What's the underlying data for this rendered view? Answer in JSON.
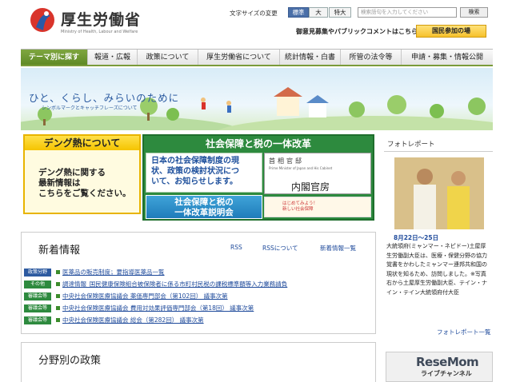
{
  "header": {
    "title": "厚生労働省",
    "subtitle": "Ministry of Health, Labour and Welfare",
    "fontsize_label": "文字サイズの変更",
    "fontsize_options": [
      "標準",
      "大",
      "特大"
    ],
    "search_placeholder": "検索語句を入力してください",
    "search_button": "検索",
    "opinion_link": "御意見募集やパブリックコメントはこちら",
    "event_button": "国民参加の場"
  },
  "nav": {
    "items": [
      "テーマ別に探す",
      "報道・広報",
      "政策について",
      "厚生労働省について",
      "統計情報・白書",
      "所管の法令等",
      "申請・募集・情報公開"
    ]
  },
  "banner": {
    "slogan": "ひと、くらし、みらいのために",
    "link": "シンボルマークとキャッチフレーズについて"
  },
  "dengue": {
    "title": "デング熱について",
    "lines": [
      "デング熱に関する",
      "最新情報は",
      "こちらをご覧ください。"
    ]
  },
  "social": {
    "title": "社会保障と税の一体改革",
    "left_text": [
      "日本の社会保障制度の現",
      "状、政策の検討状況につ",
      "いて、お知らせします。"
    ],
    "explain": [
      "社会保障と税の",
      "一体改革説明会"
    ],
    "kantei_name": "首相官邸",
    "kantei_en": "Prime Minister of Japan and His Cabinet",
    "kantei_big": "内閣官房",
    "kantei_sub": [
      "はじめてみよう！",
      "新しい社会保障"
    ]
  },
  "photo": {
    "title": "フォトレポート",
    "date": "8月22日～25日",
    "text": "大統領府(ミャンマー・ネピドー)土屋厚生労働副大臣は、医療・保健分野の協力覚書をかわしたミャンマー連邦共和国の現状を知るため、訪問しました。※写真右から土屋厚生労働副大臣、テイン・ナイン・テイン大統領府付大臣",
    "more": "フォトレポート一覧"
  },
  "news": {
    "title": "新着情報",
    "rss": "RSS",
    "rss_about": "RSSについて",
    "list": "新着情報一覧",
    "items": [
      {
        "badge": "政策分野",
        "text": "医薬品の販売制度；要指導医薬品一覧"
      },
      {
        "badge": "その他",
        "text": "調達情報_国民健康保険組合被保険者に係る市町村民税の課税標準額等入力業務請負"
      },
      {
        "badge": "審議会等",
        "text": "中央社会保険医療協議会 薬価専門部会（第102回） 議事次第"
      },
      {
        "badge": "審議会等",
        "text": "中央社会保険医療協議会 費用対効果評価専門部会（第18回） 議事次第"
      },
      {
        "badge": "審議会等",
        "text": "中央社会保険医療協議会 総会（第282回） 議事次第"
      }
    ]
  },
  "policy": {
    "title": "分野別の政策"
  },
  "live": {
    "label": "ライブチャンネル"
  },
  "watermark": "ReseMom",
  "colors": {
    "nav_active": "#6b962e",
    "news_link": "#1e4a9b",
    "dengue": "#f5c400",
    "social": "#2d8a3e"
  }
}
